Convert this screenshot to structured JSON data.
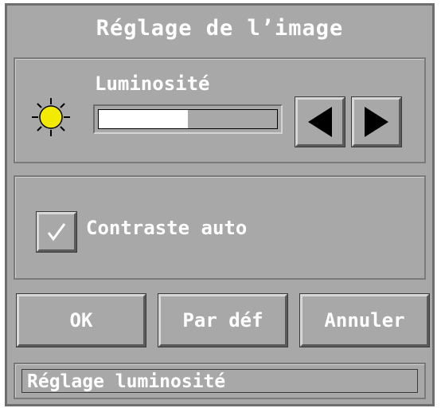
{
  "window": {
    "title": "Réglage de l’image"
  },
  "brightness": {
    "label": "Luminosité",
    "level": 0.5,
    "icon": "sun-icon",
    "decrease_icon": "arrow-left-icon",
    "increase_icon": "arrow-right-icon"
  },
  "contrast": {
    "label": "Contraste auto",
    "checked": true
  },
  "buttons": {
    "ok": "OK",
    "default": "Par déf",
    "cancel": "Annuler"
  },
  "status": {
    "text": "Réglage luminosité"
  },
  "colors": {
    "sun": "#f2ea00",
    "fill": "#ffffff",
    "background": "#a8a8a8"
  }
}
